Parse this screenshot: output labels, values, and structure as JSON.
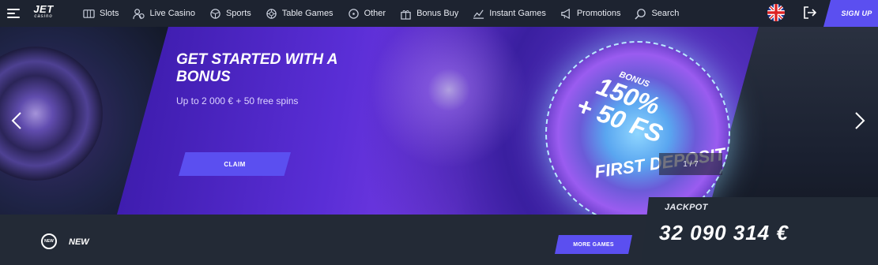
{
  "header": {
    "logo_main": "JET",
    "logo_sub": "casino",
    "nav": [
      {
        "label": "Slots",
        "icon": "slot-machine-icon"
      },
      {
        "label": "Live Casino",
        "icon": "dealer-icon"
      },
      {
        "label": "Sports",
        "icon": "sports-ball-icon"
      },
      {
        "label": "Table Games",
        "icon": "chip-icon"
      },
      {
        "label": "Other",
        "icon": "other-icon"
      },
      {
        "label": "Bonus Buy",
        "icon": "gift-box-icon"
      },
      {
        "label": "Instant Games",
        "icon": "chart-line-icon"
      },
      {
        "label": "Promotions",
        "icon": "megaphone-icon"
      },
      {
        "label": "Search",
        "icon": "search-icon"
      }
    ],
    "signup_label": "SIGN UP",
    "language_flag": "uk-flag-icon"
  },
  "hero": {
    "title": "GET STARTED WITH A BONUS",
    "subtitle": "Up to 2 000 € + 50 free spins",
    "cta_label": "CLAIM",
    "disc_bonus": "BONUS",
    "disc_percent": "150%",
    "disc_plus": "+ 50 FS",
    "disc_deposit": "FIRST DEPOSIT",
    "slide_counter": "1 / 7"
  },
  "jackpot": {
    "label": "JACKPOT",
    "value": "32 090 314 €"
  },
  "section": {
    "badge": "NEW",
    "title": "NEW",
    "more_label": "MORE GAMES"
  },
  "colors": {
    "accent": "#5b4ff0",
    "topbar": "#1d2330",
    "background": "#232a36"
  }
}
